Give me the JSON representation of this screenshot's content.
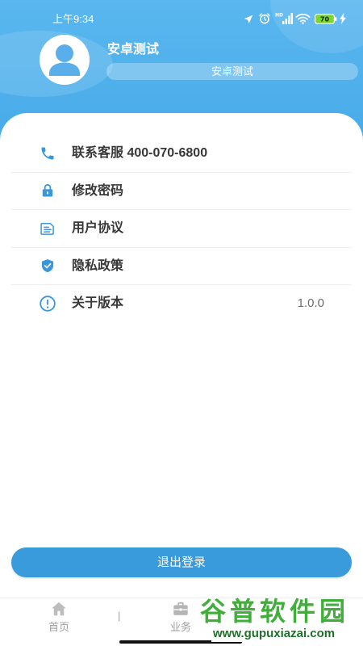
{
  "status_bar": {
    "time": "上午9:34",
    "signal_badge": "HD",
    "battery": "70",
    "icons": [
      "navigation-icon",
      "alarm-icon",
      "signal-icon",
      "wifi-icon",
      "battery-icon",
      "charging-icon"
    ]
  },
  "profile": {
    "name": "安卓测试",
    "subtitle": "安卓测试",
    "avatar_icon": "person-icon"
  },
  "menu": [
    {
      "icon": "phone-icon",
      "label": "联系客服 400-070-6800"
    },
    {
      "icon": "lock-icon",
      "label": "修改密码"
    },
    {
      "icon": "document-icon",
      "label": "用户协议"
    },
    {
      "icon": "shield-check-icon",
      "label": "隐私政策"
    },
    {
      "icon": "exclamation-circle-icon",
      "label": "关于版本",
      "value": "1.0.0"
    }
  ],
  "logout_label": "退出登录",
  "tabs": [
    {
      "icon": "home-icon",
      "label": "首页"
    },
    {
      "icon": "briefcase-icon",
      "label": "业务"
    }
  ],
  "tab_separator": "|",
  "watermark": {
    "brand": "谷普软件园",
    "url": "www.gupuxiazai.com"
  },
  "colors": {
    "header": "#52b2ec",
    "accent": "#3a9bdc",
    "icon": "#3a97d8",
    "text": "#383838",
    "muted": "#9e9e9e",
    "battery": "#7bd62f",
    "watermark": "#3faf3a"
  }
}
